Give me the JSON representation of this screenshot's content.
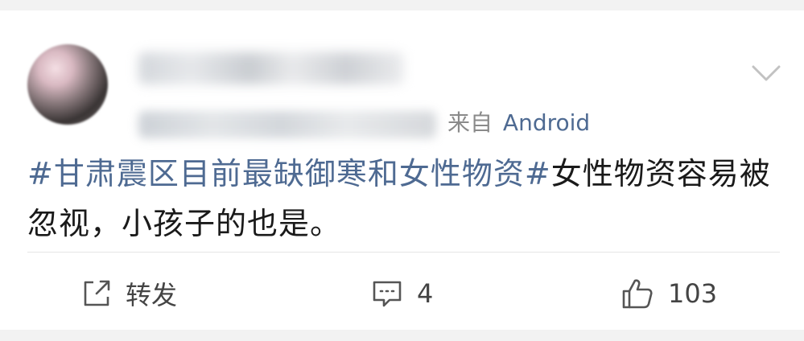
{
  "post": {
    "source_prefix": "来自",
    "device": "Android",
    "content": {
      "topic": "#甘肃震区目前最缺御寒和女性物资#",
      "text": "女性物资容易被忽视，小孩子的也是。"
    }
  },
  "actions": {
    "repost_label": "转发",
    "comment_count": "4",
    "like_count": "103"
  },
  "icons": {
    "menu": "chevron-down-icon",
    "repost": "repost-icon",
    "comment": "comment-icon",
    "like": "thumbs-up-icon"
  },
  "colors": {
    "topic": "#4e6a92",
    "text": "#1a1a1a",
    "muted": "#8a8a8a"
  }
}
